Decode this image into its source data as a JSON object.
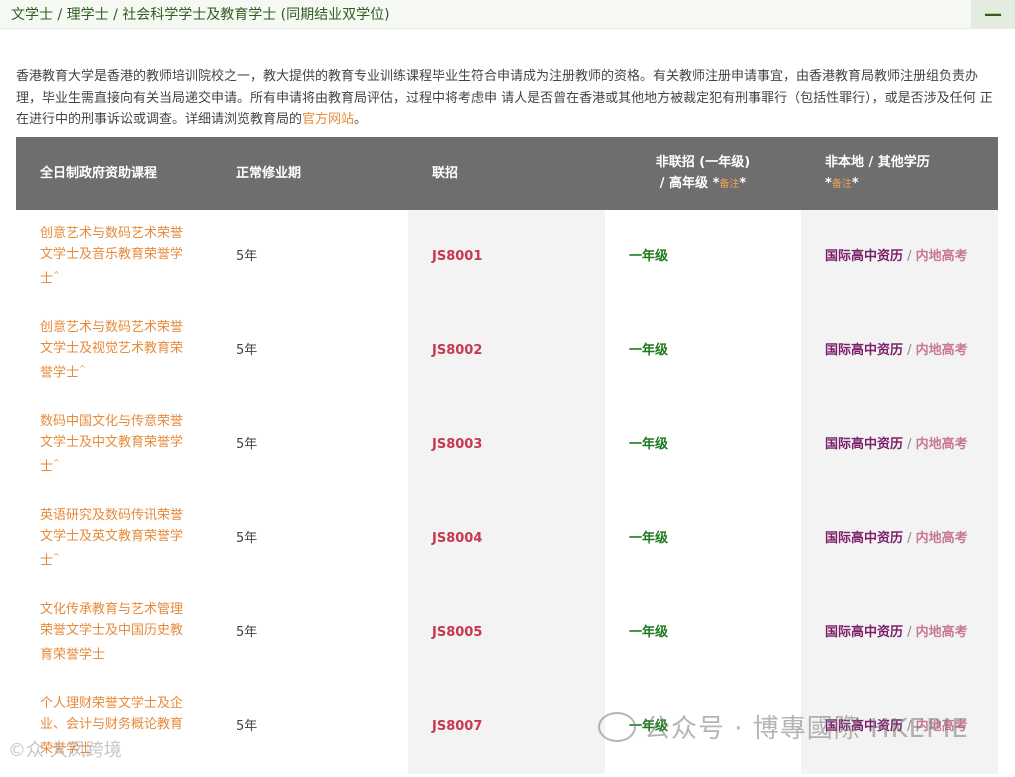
{
  "header": {
    "title": "文学士 / 理学士 / 社会科学学士及教育学士 (同期结业双学位)",
    "toggle_symbol": "—"
  },
  "intro": {
    "text": "香港教育大学是香港的教师培训院校之一，教大提供的教育专业训练课程毕业生符合申请成为注册教师的资格。有关教师注册申请事宜，由香港教育局教师注册组负责办 理，毕业生需直接向有关当局递交申请。所有申请将由教育局评估，过程中将考虑申 请人是否曾在香港或其他地方被裁定犯有刑事罪行（包括性罪行），或是否涉及任何 正在进行中的刑事诉讼或调查。详细请浏览教育局的",
    "link_text": "官方网站",
    "end_text": "。"
  },
  "table": {
    "headers": {
      "program": "全日制政府资助课程",
      "duration": "正常修业期",
      "jupas": "联招",
      "non_jupas_line1": "非联招 (一年级)",
      "non_jupas_line2": "/ 高年级 *",
      "non_jupas_note": "备注",
      "non_jupas_star": "*",
      "nonlocal_line1": "非本地 / 其他学历",
      "nonlocal_prefix": "*",
      "nonlocal_note": "备注",
      "nonlocal_star": "*"
    },
    "rows": [
      {
        "program": "创意艺术与数码艺术荣誉文学士及音乐教育荣誉学士",
        "sup": "^",
        "duration": "5年",
        "code": "JS8001",
        "grade": "一年级",
        "intl": "国际高中资历",
        "sep": " / ",
        "mainland": "内地高考"
      },
      {
        "program": "创意艺术与数码艺术荣誉文学士及视觉艺术教育荣誉学士",
        "sup": "^",
        "duration": "5年",
        "code": "JS8002",
        "grade": "一年级",
        "intl": "国际高中资历",
        "sep": " / ",
        "mainland": "内地高考"
      },
      {
        "program": "数码中国文化与传意荣誉文学士及中文教育荣誉学士",
        "sup": "^",
        "duration": "5年",
        "code": "JS8003",
        "grade": "一年级",
        "intl": "国际高中资历",
        "sep": " / ",
        "mainland": "内地高考"
      },
      {
        "program": "英语研究及数码传讯荣誉文学士及英文教育荣誉学士",
        "sup": "^",
        "duration": "5年",
        "code": "JS8004",
        "grade": "一年级",
        "intl": "国际高中资历",
        "sep": " / ",
        "mainland": "内地高考"
      },
      {
        "program": "文化传承教育与艺术管理荣誉文学士及中国历史教育荣誉学士",
        "sup": "",
        "duration": "5年",
        "code": "JS8005",
        "grade": "一年级",
        "intl": "国际高中资历",
        "sep": " / ",
        "mainland": "内地高考"
      },
      {
        "program": "个人理财荣誉文学士及企业、会计与财务概论教育荣誉学士",
        "sup": "",
        "duration": "5年",
        "code": "JS8007",
        "grade": "一年级",
        "intl": "国际高中资历",
        "sep": " / ",
        "mainland": "内地高考"
      }
    ]
  },
  "watermarks": {
    "main": "公众号 · 博專國際 HKEPIE",
    "secondary": "©众 大凤跨境"
  }
}
